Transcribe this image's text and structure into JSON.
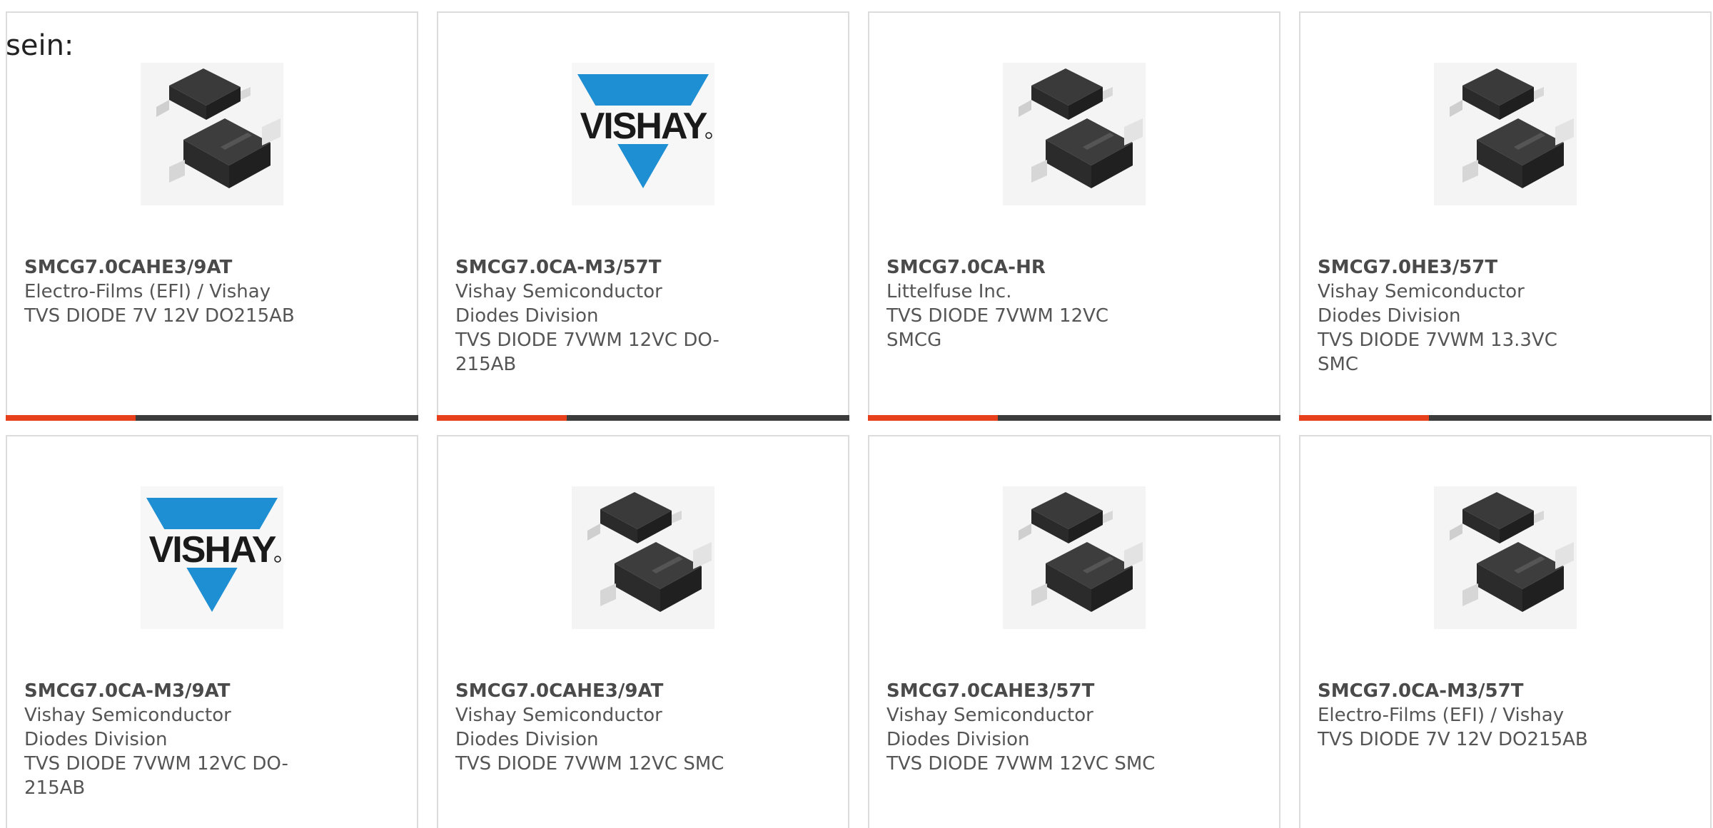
{
  "intro_text": "sein:",
  "colors": {
    "accent": "#e8401c",
    "dark_bar": "#3c3c3c",
    "border": "#dcdcdc",
    "vishay_blue": "#1e8fd3"
  },
  "cards": [
    {
      "part_number": "SMCG7.0CAHE3/9AT",
      "manufacturer": "Electro-Films (EFI) / Vishay",
      "description": "TVS DIODE 7V 12V DO215AB",
      "image": "diode-package-icon"
    },
    {
      "part_number": "SMCG7.0CA-M3/57T",
      "manufacturer": "Vishay Semiconductor Diodes Division",
      "description": "TVS DIODE 7VWM 12VC DO-215AB",
      "image": "vishay-logo"
    },
    {
      "part_number": "SMCG7.0CA-HR",
      "manufacturer": "Littelfuse Inc.",
      "description": "TVS DIODE 7VWM 12VC SMCG",
      "image": "diode-package-icon"
    },
    {
      "part_number": "SMCG7.0HE3/57T",
      "manufacturer": "Vishay Semiconductor Diodes Division",
      "description": "TVS DIODE 7VWM 13.3VC SMC",
      "image": "diode-package-icon"
    },
    {
      "part_number": "SMCG7.0CA-M3/9AT",
      "manufacturer": "Vishay Semiconductor Diodes Division",
      "description": "TVS DIODE 7VWM 12VC DO-215AB",
      "image": "vishay-logo"
    },
    {
      "part_number": "SMCG7.0CAHE3/9AT",
      "manufacturer": "Vishay Semiconductor Diodes Division",
      "description": "TVS DIODE 7VWM 12VC SMC",
      "image": "diode-package-icon"
    },
    {
      "part_number": "SMCG7.0CAHE3/57T",
      "manufacturer": "Vishay Semiconductor Diodes Division",
      "description": "TVS DIODE 7VWM 12VC SMC",
      "image": "diode-package-icon"
    },
    {
      "part_number": "SMCG7.0CA-M3/57T",
      "manufacturer": "Electro-Films (EFI) / Vishay",
      "description": "TVS DIODE 7V 12V DO215AB",
      "image": "diode-package-icon"
    }
  ],
  "vishay_logo_text": "VISHAY"
}
